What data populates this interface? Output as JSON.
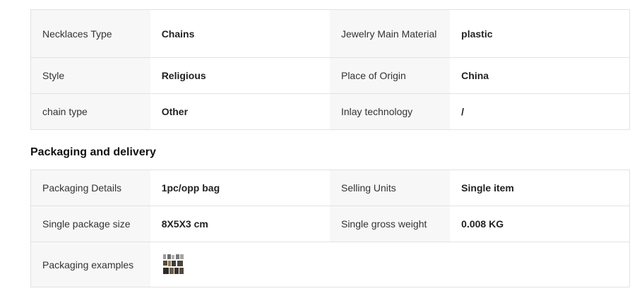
{
  "attributes": {
    "rows": [
      {
        "label1": "Necklaces Type",
        "value1": "Chains",
        "label2": "Jewelry Main Material",
        "value2": "plastic"
      },
      {
        "label1": "Style",
        "value1": "Religious",
        "label2": "Place of Origin",
        "value2": "China"
      },
      {
        "label1": "chain type",
        "value1": "Other",
        "label2": "Inlay technology",
        "value2": "/"
      }
    ]
  },
  "packaging": {
    "title": "Packaging and delivery",
    "rows": [
      {
        "label1": "Packaging Details",
        "value1": "1pc/opp bag",
        "label2": "Selling Units",
        "value2": "Single item"
      },
      {
        "label1": "Single package size",
        "value1": "8X5X3 cm",
        "label2": "Single gross weight",
        "value2": "0.008 KG"
      }
    ],
    "examples_label": "Packaging examples"
  }
}
